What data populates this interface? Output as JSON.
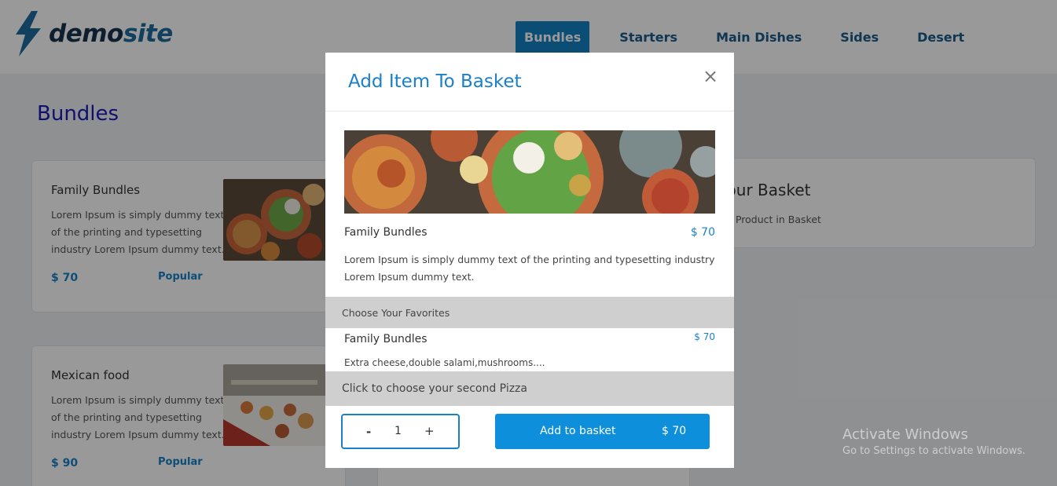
{
  "brand": {
    "name_part1": "demo",
    "name_part2": "site"
  },
  "nav": {
    "items": [
      {
        "label": "Bundles",
        "active": true
      },
      {
        "label": "Starters",
        "active": false
      },
      {
        "label": "Main Dishes",
        "active": false
      },
      {
        "label": "Sides",
        "active": false
      },
      {
        "label": "Desert",
        "active": false
      }
    ]
  },
  "page": {
    "title": "Bundles"
  },
  "cards": [
    {
      "title": "Family Bundles",
      "description": "Lorem Ipsum is simply dummy text of the printing and typesetting industry Lorem Ipsum dummy text.",
      "price": "$ 70",
      "tag": "Popular"
    },
    {
      "title": "Mexican food",
      "description": "Lorem Ipsum is simply dummy text of the printing and typesetting industry Lorem Ipsum dummy text.",
      "price": "$ 90",
      "tag": "Popular"
    }
  ],
  "basket": {
    "title": "Your Basket",
    "empty_text": "No Product in Basket"
  },
  "modal": {
    "title": "Add Item To Basket",
    "close_glyph": "×",
    "item": {
      "name": "Family Bundles",
      "price": "$ 70",
      "description": "Lorem Ipsum is simply dummy text of the printing and typesetting industry Lorem Ipsum dummy text."
    },
    "favorites_label": "Choose Your Favorites",
    "option": {
      "name": "Family Bundles",
      "price": "$ 70",
      "description": "Extra cheese,double salami,mushrooms...."
    },
    "second_pizza_label": "Click to choose your second Pizza",
    "stepper": {
      "minus": "-",
      "quantity": "1",
      "plus": "+"
    },
    "add_button": {
      "label": "Add to basket",
      "price": "$ 70"
    }
  },
  "watermark": {
    "line1": "Activate Windows",
    "line2": "Go to Settings to activate Windows."
  },
  "colors": {
    "brand_blue": "#1a80c9",
    "nav_active_bg": "#1381c4",
    "page_title": "#1b1bb8",
    "button_bg": "#0d8fdc"
  }
}
